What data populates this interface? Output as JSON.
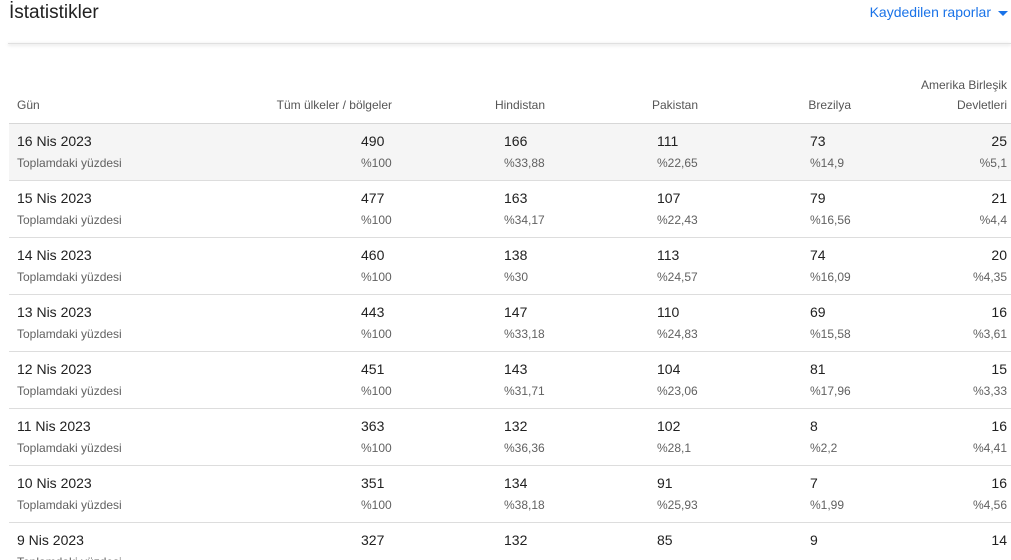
{
  "header": {
    "title": "İstatistikler",
    "saved_reports_label": "Kaydedilen raporlar"
  },
  "table": {
    "columns": {
      "day": "Gün",
      "all": "Tüm ülkeler / bölgeler",
      "india": "Hindistan",
      "pakistan": "Pakistan",
      "brazil": "Brezilya",
      "usa_line1": "Amerika Birleşik",
      "usa_line2": "Devletleri"
    },
    "sub_label": "Toplamdaki yüzdesi",
    "rows": [
      {
        "day": "16 Nis 2023",
        "all": "490",
        "all_pct": "%100",
        "india": "166",
        "india_pct": "%33,88",
        "pakistan": "111",
        "pakistan_pct": "%22,65",
        "brazil": "73",
        "brazil_pct": "%14,9",
        "usa": "25",
        "usa_pct": "%5,1"
      },
      {
        "day": "15 Nis 2023",
        "all": "477",
        "all_pct": "%100",
        "india": "163",
        "india_pct": "%34,17",
        "pakistan": "107",
        "pakistan_pct": "%22,43",
        "brazil": "79",
        "brazil_pct": "%16,56",
        "usa": "21",
        "usa_pct": "%4,4"
      },
      {
        "day": "14 Nis 2023",
        "all": "460",
        "all_pct": "%100",
        "india": "138",
        "india_pct": "%30",
        "pakistan": "113",
        "pakistan_pct": "%24,57",
        "brazil": "74",
        "brazil_pct": "%16,09",
        "usa": "20",
        "usa_pct": "%4,35"
      },
      {
        "day": "13 Nis 2023",
        "all": "443",
        "all_pct": "%100",
        "india": "147",
        "india_pct": "%33,18",
        "pakistan": "110",
        "pakistan_pct": "%24,83",
        "brazil": "69",
        "brazil_pct": "%15,58",
        "usa": "16",
        "usa_pct": "%3,61"
      },
      {
        "day": "12 Nis 2023",
        "all": "451",
        "all_pct": "%100",
        "india": "143",
        "india_pct": "%31,71",
        "pakistan": "104",
        "pakistan_pct": "%23,06",
        "brazil": "81",
        "brazil_pct": "%17,96",
        "usa": "15",
        "usa_pct": "%3,33"
      },
      {
        "day": "11 Nis 2023",
        "all": "363",
        "all_pct": "%100",
        "india": "132",
        "india_pct": "%36,36",
        "pakistan": "102",
        "pakistan_pct": "%28,1",
        "brazil": "8",
        "brazil_pct": "%2,2",
        "usa": "16",
        "usa_pct": "%4,41"
      },
      {
        "day": "10 Nis 2023",
        "all": "351",
        "all_pct": "%100",
        "india": "134",
        "india_pct": "%38,18",
        "pakistan": "91",
        "pakistan_pct": "%25,93",
        "brazil": "7",
        "brazil_pct": "%1,99",
        "usa": "16",
        "usa_pct": "%4,56"
      },
      {
        "day": "9 Nis 2023",
        "all": "327",
        "all_pct": "",
        "india": "132",
        "india_pct": "",
        "pakistan": "85",
        "pakistan_pct": "",
        "brazil": "9",
        "brazil_pct": "",
        "usa": "14",
        "usa_pct": ""
      }
    ]
  },
  "colors": {
    "accent": "#1a73e8",
    "row_highlight": "#f5f5f5"
  },
  "icons": {
    "saved_reports_caret": "caret-down-icon"
  }
}
